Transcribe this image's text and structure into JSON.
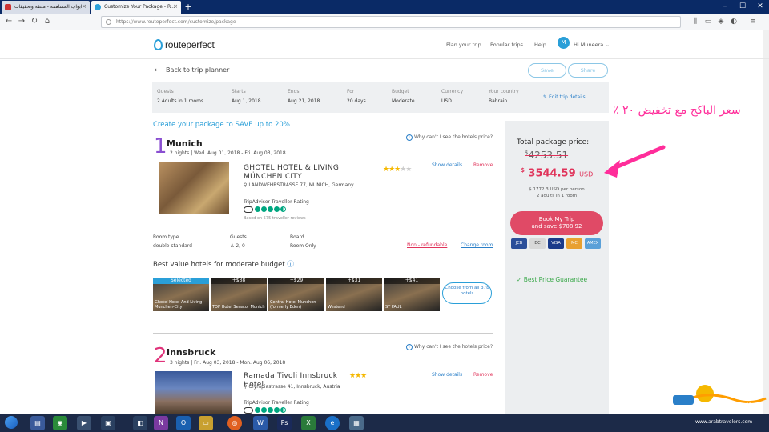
{
  "browser": {
    "tabs": [
      {
        "label": "ابواب المساهمة - منتقة وتحقيقات",
        "active": false
      },
      {
        "label": "Customize Your Package - R...",
        "active": true
      }
    ],
    "new_tab": "+",
    "address": "https://www.routeperfect.com/customize/package"
  },
  "site": {
    "logo": "routeperfect",
    "nav": [
      "Plan your trip",
      "Popular trips",
      "Help"
    ],
    "user_initial": "M",
    "user_name": "Hi Muneera"
  },
  "toolbar": {
    "back_label": "Back to trip planner",
    "save_label": "Save",
    "share_label": "Share"
  },
  "trip_info": {
    "guests": {
      "label": "Guests",
      "value": "2 Adults in 1 rooms"
    },
    "starts": {
      "label": "Starts",
      "value": "Aug 1, 2018"
    },
    "ends": {
      "label": "Ends",
      "value": "Aug 21, 2018"
    },
    "for": {
      "label": "For",
      "value": "20 days"
    },
    "budget": {
      "label": "Budget",
      "value": "Moderate"
    },
    "currency": {
      "label": "Currency",
      "value": "USD"
    },
    "country": {
      "label": "Your country",
      "value": "Bahrain"
    },
    "edit_label": "Edit trip details"
  },
  "promo": "Create your package to SAVE up to 20%",
  "cities": [
    {
      "number": "1",
      "name": "Munich",
      "dates": "2 nights | Wed. Aug 01, 2018 - Fri. Aug 03, 2018",
      "why_label": "Why can't I see the hotels price?",
      "hotel_name": "GHOTEL HOTEL & LIVING MÜNCHEN CITY",
      "stars": 3,
      "address": "LANDWEHRSTRASSE 77, MUNICH, Germany",
      "tripadvisor_label": "TripAdvisor Traveller Rating",
      "reviews": "Based on 575 traveller reviews",
      "show_details": "Show details",
      "remove": "Remove",
      "room_type": {
        "label": "Room type",
        "value": "double standard"
      },
      "guests": {
        "label": "Guests",
        "value": "2, 0"
      },
      "board": {
        "label": "Board",
        "value": "Room Only"
      },
      "non_refundable": "Non - refundable",
      "change_room": "Change room"
    },
    {
      "number": "2",
      "name": "Innsbruck",
      "dates": "3 nights | Fri. Aug 03, 2018 - Mon. Aug 06, 2018",
      "why_label": "Why can't I see the hotels price?",
      "hotel_name": "Ramada Tivoli Innsbruck Hotel",
      "stars": 3,
      "address": "Olympiastrasse 41, Innsbruck, Austria",
      "tripadvisor_label": "TripAdvisor Traveller Rating",
      "show_details": "Show details",
      "remove": "Remove"
    }
  ],
  "best_value": {
    "title": "Best value hotels for moderate budget",
    "thumbs": [
      {
        "tag": "Selected",
        "caption": "Ghotel Hotel And Living Munchen-City"
      },
      {
        "tag": "+$38",
        "caption": "TOP Hotel Senator Munich"
      },
      {
        "tag": "+$29",
        "caption": "Central Hotel Munchen (formerly Eden)"
      },
      {
        "tag": "+$31",
        "caption": "Westend"
      },
      {
        "tag": "+$41",
        "caption": "ST PAUL"
      }
    ],
    "choose_label": "Choose from all 378 hotels"
  },
  "price": {
    "total_label": "Total package price:",
    "old_currency": "$",
    "old_price": "4253.51",
    "new_currency": "$",
    "new_price": "3544.59",
    "new_unit": "USD",
    "per_person": "$ 1772.3 USD per person",
    "adults": "2 adults in 1 room",
    "book_label": "Book My Trip",
    "save_text": "and save $708.92",
    "cards": [
      "JCB",
      "DC",
      "VISA",
      "MC",
      "AMEX"
    ],
    "guarantee": "Best Price Guarantee"
  },
  "annotation": {
    "text": "سعر الباكج مع تخفيض ٢٠ ٪"
  },
  "watermark": {
    "name": "المسافرون العرب",
    "url": "www.arabtravelers.com"
  },
  "colors": {
    "brand_blue": "#2a9fd8",
    "sale_pink": "#e0335a",
    "book_button": "#e04a66",
    "city1": "#8a4fd1",
    "city2": "#e0337a",
    "annotation": "#ff2d9a",
    "guarantee_green": "#3aa84a"
  }
}
